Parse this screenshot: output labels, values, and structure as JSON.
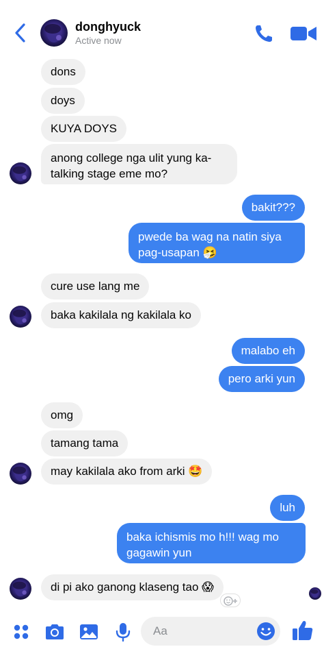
{
  "header": {
    "name": "donghyuck",
    "status": "Active now"
  },
  "colors": {
    "accent": "#2f6be6",
    "outgoing_bubble": "#3c82f0",
    "incoming_bubble": "#f0f0f0"
  },
  "messages": [
    {
      "side": "in",
      "text": "dons"
    },
    {
      "side": "in",
      "text": "doys"
    },
    {
      "side": "in",
      "text": "KUYA DOYS"
    },
    {
      "side": "in",
      "text": "anong college nga ulit yung ka-talking stage eme mo?"
    },
    {
      "side": "out",
      "text": "bakit???"
    },
    {
      "side": "out",
      "text": "pwede ba wag na natin siya pag-usapan 🤧"
    },
    {
      "side": "in",
      "text": "cure use lang me"
    },
    {
      "side": "in",
      "text": "baka kakilala ng kakilala ko"
    },
    {
      "side": "out",
      "text": "malabo eh"
    },
    {
      "side": "out",
      "text": "pero arki yun"
    },
    {
      "side": "in",
      "text": "omg"
    },
    {
      "side": "in",
      "text": "tamang tama"
    },
    {
      "side": "in",
      "text": "may kakilala ako from arki 🤩"
    },
    {
      "side": "out",
      "text": "luh"
    },
    {
      "side": "out",
      "text": "baka ichismis mo h!!! wag mo gagawin yun"
    },
    {
      "side": "in",
      "text": "di pi ako ganong klaseng tao 😱"
    }
  ],
  "composer": {
    "placeholder": "Aa",
    "icons": [
      "grid-icon",
      "camera-icon",
      "image-icon",
      "microphone-icon",
      "emoji-icon",
      "thumbs-up-icon"
    ]
  }
}
